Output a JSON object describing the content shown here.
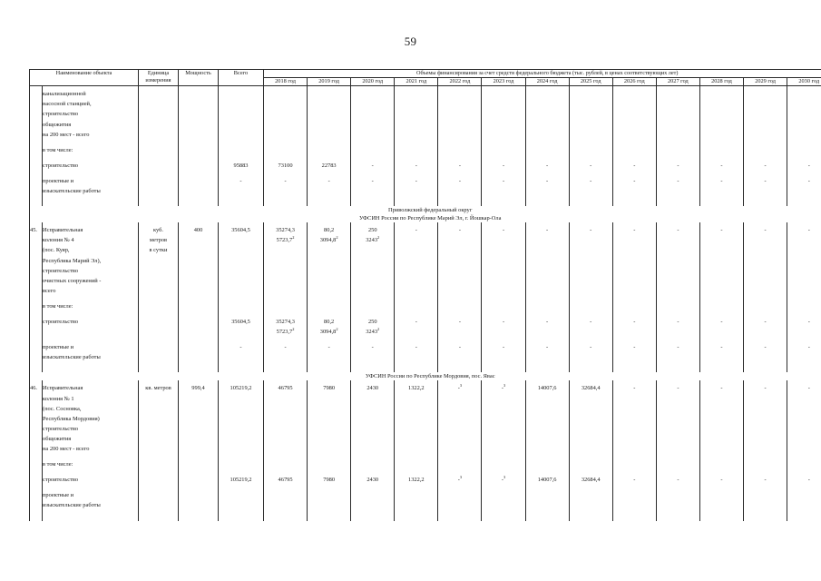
{
  "page": {
    "number": "59"
  },
  "table": {
    "header": {
      "col_name": "Наименование объекта",
      "col_unit_line1": "Единица",
      "col_unit_line2": "измерения",
      "col_power": "Мощность",
      "col_total": "Всего",
      "col_funding_span": "Объемы финансирования за счет средств федерального бюджета (тыс. рублей, в ценах соответствующих лет)",
      "years": [
        "2018 год",
        "2019 год",
        "2020 год",
        "2021 год",
        "2022 год",
        "2023 год",
        "2024 год",
        "2025 год",
        "2026 год",
        "2027 год",
        "2028 год",
        "2029 год",
        "2030 год"
      ]
    },
    "continued_item": {
      "name_lines": [
        "канализационной",
        "насосной станцией,",
        "строительство",
        "общежития",
        "на 200 мест - всего"
      ],
      "including_label": "в том числе:",
      "sub_rows": [
        {
          "label_lines": [
            "строительство"
          ],
          "unit": "",
          "power": "",
          "total": "95883",
          "values": [
            "73100",
            "22783",
            "-",
            "-",
            "-",
            "-",
            "-",
            "-",
            "-",
            "-",
            "-",
            "-",
            "-"
          ]
        },
        {
          "label_lines": [
            "проектные и",
            "изыскательские работы"
          ],
          "unit": "",
          "power": "",
          "total": "-",
          "values": [
            "-",
            "-",
            "-",
            "-",
            "-",
            "-",
            "-",
            "-",
            "-",
            "-",
            "-",
            "-",
            "-"
          ]
        }
      ]
    },
    "sections": [
      {
        "district_title": "Приволжский федеральный округ",
        "office_title": "УФСИН России по Республике Марий Эл, г. Йошкар-Ола",
        "items": [
          {
            "number": "45.",
            "name_lines": [
              "Исправительная",
              "колония № 4",
              "(пос. Куяр,",
              "Республика Марий Эл),",
              "строительство",
              "очистных сооружений -",
              "всего"
            ],
            "unit_lines": [
              "куб.",
              "метров",
              "в сутки"
            ],
            "power": "400",
            "total": "35604,5",
            "values": [
              "35274,3",
              "80,2",
              "250",
              "-",
              "-",
              "-",
              "-",
              "-",
              "-",
              "-",
              "-",
              "-",
              "-"
            ],
            "values_second": [
              "5723,7²",
              "3094,8²",
              "3243²",
              "",
              "",
              "",
              "",
              "",
              "",
              "",
              "",
              "",
              ""
            ],
            "including_label": "в том числе:",
            "sub_rows": [
              {
                "label_lines": [
                  "строительство"
                ],
                "total": "35604,5",
                "values": [
                  "35274,3",
                  "80,2",
                  "250",
                  "-",
                  "-",
                  "-",
                  "-",
                  "-",
                  "-",
                  "-",
                  "-",
                  "-",
                  "-"
                ],
                "values_second": [
                  "5723,7²",
                  "3094,8²",
                  "3243²",
                  "",
                  "",
                  "",
                  "",
                  "",
                  "",
                  "",
                  "",
                  "",
                  ""
                ]
              },
              {
                "label_lines": [
                  "проектные и",
                  "изыскательские работы"
                ],
                "total": "-",
                "values": [
                  "-",
                  "-",
                  "-",
                  "-",
                  "-",
                  "-",
                  "-",
                  "-",
                  "-",
                  "-",
                  "-",
                  "-",
                  "-"
                ],
                "values_second": [
                  "",
                  "",
                  "",
                  "",
                  "",
                  "",
                  "",
                  "",
                  "",
                  "",
                  "",
                  "",
                  ""
                ]
              }
            ]
          }
        ]
      },
      {
        "district_title": "",
        "office_title": "УФСИН России по Республике Мордовия, пос. Явас",
        "items": [
          {
            "number": "46.",
            "name_lines": [
              "Исправительная",
              "колония № 1",
              "(пос. Сосновка,",
              "Республика Мордовия)",
              "строительство",
              "общежития",
              "на 200 мест - всего"
            ],
            "unit_lines": [
              "кв. метров"
            ],
            "power": "999,4",
            "total": "105219,2",
            "values": [
              "46795",
              "7980",
              "2430",
              "1322,2",
              "-³",
              "-³",
              "14007,6",
              "32684,4",
              "-",
              "-",
              "-",
              "-",
              "-"
            ],
            "values_second": [
              "",
              "",
              "",
              "",
              "",
              "",
              "",
              "",
              "",
              "",
              "",
              "",
              ""
            ],
            "including_label": "в том числе:",
            "sub_rows": [
              {
                "label_lines": [
                  "строительство"
                ],
                "total": "105219,2",
                "values": [
                  "46795",
                  "7980",
                  "2430",
                  "1322,2",
                  "-³",
                  "-³",
                  "14007,6",
                  "32684,4",
                  "-",
                  "-",
                  "-",
                  "-",
                  "-"
                ],
                "values_second": [
                  "",
                  "",
                  "",
                  "",
                  "",
                  "",
                  "",
                  "",
                  "",
                  "",
                  "",
                  "",
                  ""
                ]
              },
              {
                "label_lines": [
                  "проектные и",
                  "изыскательские работы"
                ],
                "total": "",
                "values": [
                  "",
                  "",
                  "",
                  "",
                  "",
                  "",
                  "",
                  "",
                  "",
                  "",
                  "",
                  "",
                  ""
                ],
                "values_second": [
                  "",
                  "",
                  "",
                  "",
                  "",
                  "",
                  "",
                  "",
                  "",
                  "",
                  "",
                  "",
                  ""
                ]
              }
            ]
          }
        ]
      }
    ]
  }
}
